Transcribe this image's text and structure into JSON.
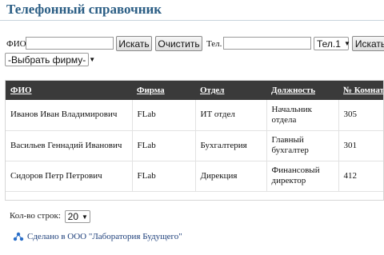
{
  "header": {
    "title": "Телефонный справочник"
  },
  "search": {
    "fio_label": "ФИО",
    "fio_value": "",
    "search_button": "Искать",
    "clear_button": "Очистить",
    "tel_label": "Тел.",
    "tel_value": "",
    "tel_select": "Тел.1",
    "search_button2": "Искать",
    "company_select": "-Выбрать фирму-"
  },
  "table": {
    "columns": [
      "ФИО",
      "Фирма",
      "Отдел",
      "Должность",
      "№ Комнаты"
    ],
    "rows": [
      [
        "Иванов Иван Владимирович",
        "FLab",
        "ИТ отдел",
        "Начальник отдела",
        "305"
      ],
      [
        "Васильев Геннадий Иванович",
        "FLab",
        "Бухгалтерия",
        "Главный бухгалтер",
        "301"
      ],
      [
        "Сидоров Петр Петрович",
        "FLab",
        "Дирекция",
        "Финансовый директор",
        "412"
      ]
    ]
  },
  "pager": {
    "label": "Кол-во строк:",
    "value": "20"
  },
  "footer": {
    "text": "Сделано в ООО \"Лаборатория Будущего\"",
    "icon": "molecule-icon"
  }
}
